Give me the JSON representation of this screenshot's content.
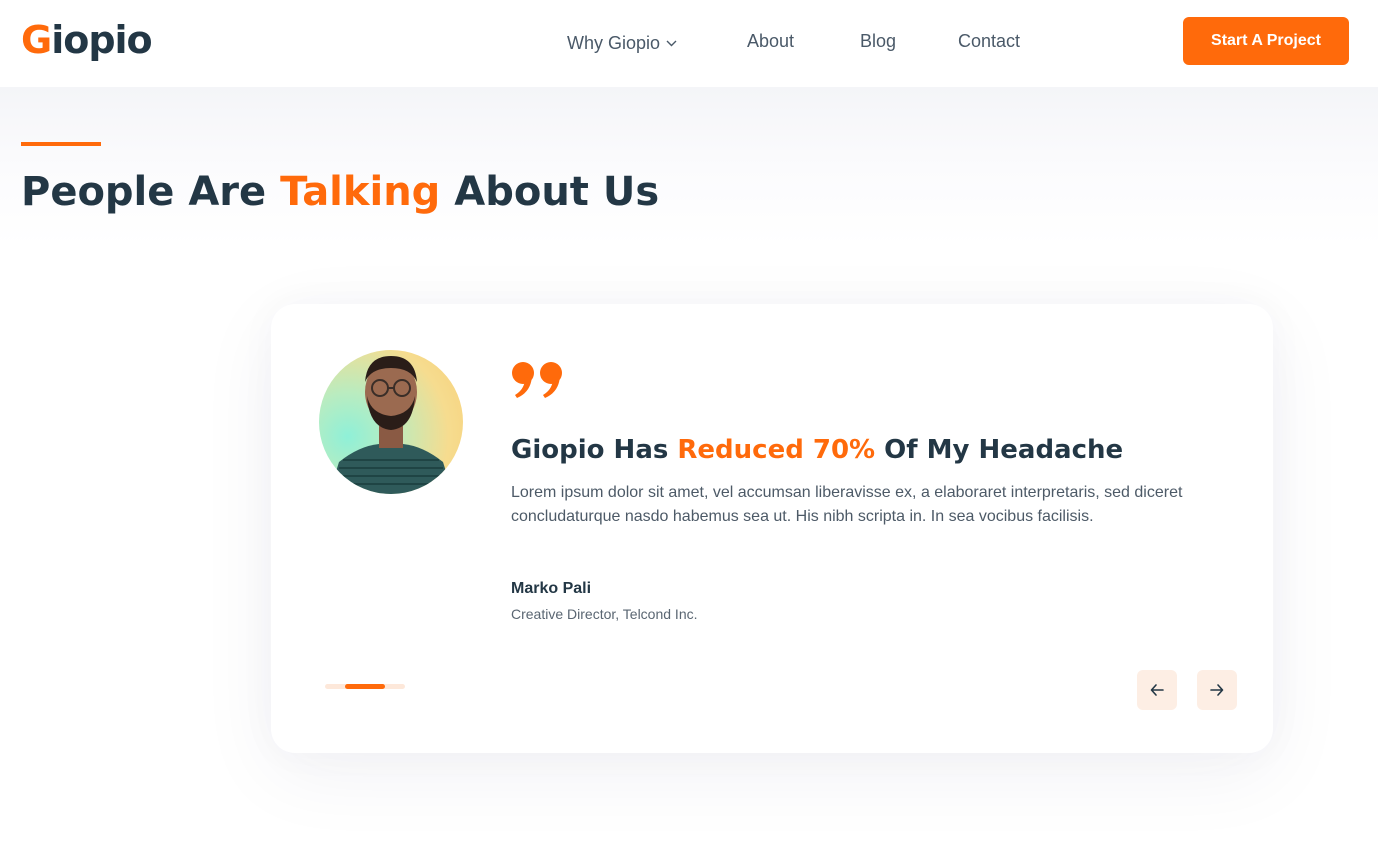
{
  "brand": {
    "logo_initial": "G",
    "logo_rest": "iopio",
    "accent": "#ff6a0b",
    "text": "#233745"
  },
  "nav": {
    "items": [
      {
        "label": "Why Giopio",
        "has_dropdown": true
      },
      {
        "label": "About"
      },
      {
        "label": "Blog"
      },
      {
        "label": "Contact"
      }
    ],
    "cta_label": "Start A Project"
  },
  "section": {
    "heading_pre": "People Are ",
    "heading_highlight": "Talking",
    "heading_post": " About Us"
  },
  "testimonial": {
    "title_pre": "Giopio Has ",
    "title_highlight": "Reduced 70%",
    "title_post": " Of My Headache",
    "body": "Lorem ipsum dolor sit amet, vel accumsan liberavisse ex, a elaboraret interpretaris, sed diceret concludaturque nasdo habemus sea ut. His nibh scripta in. In sea vocibus facilisis.",
    "author_name": "Marko Pali",
    "author_role": "Creative Director, Telcond Inc.",
    "icons": {
      "quote": "quote-icon",
      "prev": "arrow-left-icon",
      "next": "arrow-right-icon"
    }
  }
}
